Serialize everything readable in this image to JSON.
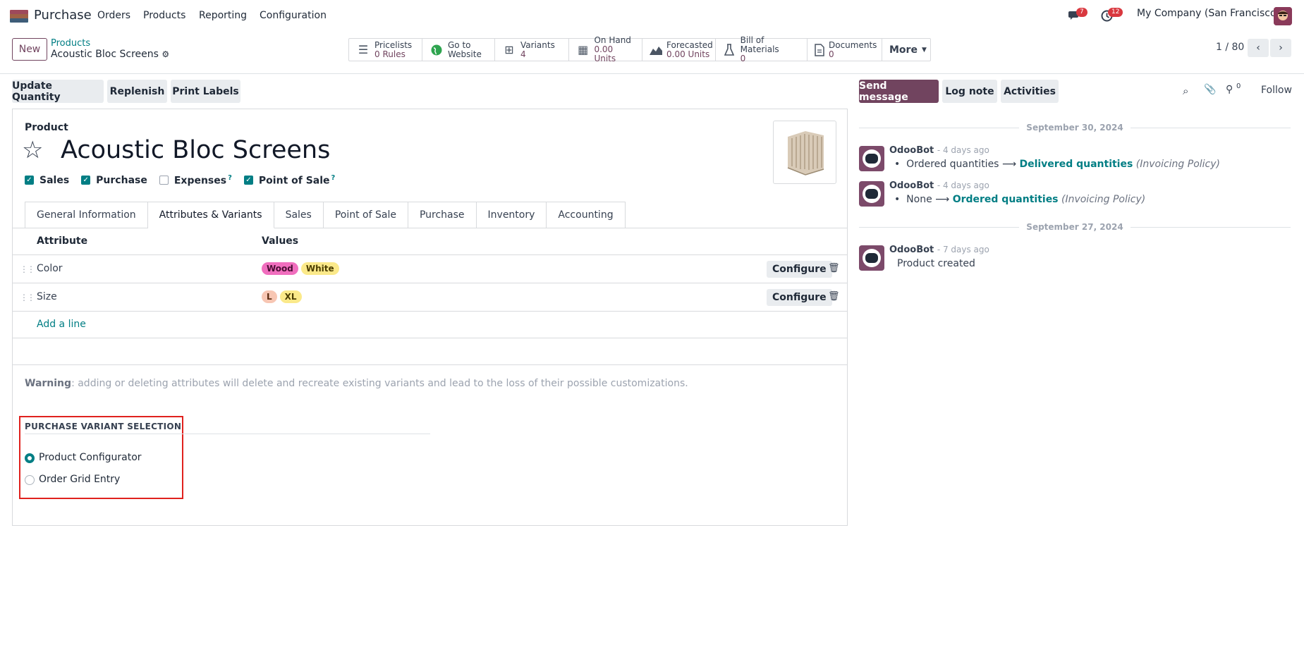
{
  "topbar": {
    "app_name": "Purchase",
    "menu": [
      "Orders",
      "Products",
      "Reporting",
      "Configuration"
    ],
    "messages_badge": "7",
    "activities_badge": "12",
    "company": "My Company (San Francisco)"
  },
  "control": {
    "new_label": "New",
    "breadcrumb_parent": "Products",
    "breadcrumb_current": "Acoustic Bloc Screens",
    "pager": "1 / 80",
    "stats": [
      {
        "icon": "list-icon",
        "label": "Pricelists",
        "value": "0 Rules"
      },
      {
        "icon": "globe-icon",
        "label": "Go to",
        "value": "Website"
      },
      {
        "icon": "sitemap-icon",
        "label": "Variants",
        "value": "4"
      },
      {
        "icon": "cubes-icon",
        "label": "On Hand",
        "value": "0.00 Units"
      },
      {
        "icon": "area-chart-icon",
        "label": "Forecasted",
        "value": "0.00 Units"
      },
      {
        "icon": "flask-icon",
        "label": "Bill of Materials",
        "value": "0"
      },
      {
        "icon": "file-icon",
        "label": "Documents",
        "value": "0"
      }
    ],
    "more_label": "More"
  },
  "actions": {
    "update_quantity": "Update Quantity",
    "replenish": "Replenish",
    "print_labels": "Print Labels"
  },
  "form": {
    "type_label": "Product",
    "name": "Acoustic Bloc Screens",
    "checkboxes": [
      {
        "label": "Sales",
        "checked": true,
        "help": false
      },
      {
        "label": "Purchase",
        "checked": true,
        "help": false
      },
      {
        "label": "Expenses",
        "checked": false,
        "help": true
      },
      {
        "label": "Point of Sale",
        "checked": true,
        "help": true
      }
    ],
    "help_mark": "?",
    "tabs": [
      "General Information",
      "Attributes & Variants",
      "Sales",
      "Point of Sale",
      "Purchase",
      "Inventory",
      "Accounting"
    ],
    "active_tab": "Attributes & Variants",
    "table": {
      "headers": [
        "Attribute",
        "Values"
      ],
      "rows": [
        {
          "attribute": "Color",
          "values": [
            {
              "text": "Wood",
              "color": "#f06ebe"
            },
            {
              "text": "White",
              "color": "#fbe98a"
            }
          ]
        },
        {
          "attribute": "Size",
          "values": [
            {
              "text": "L",
              "color": "#f7c6b3"
            },
            {
              "text": "XL",
              "color": "#fbe98a"
            }
          ]
        }
      ],
      "configure_label": "Configure",
      "add_line": "Add a line"
    },
    "warning_bold": "Warning",
    "warning_text": ": adding or deleting attributes will delete and recreate existing variants and lead to the loss of their possible customizations.",
    "pvs_title": "PURCHASE VARIANT SELECTION",
    "pvs_options": [
      {
        "label": "Product Configurator",
        "selected": true
      },
      {
        "label": "Order Grid Entry",
        "selected": false
      }
    ]
  },
  "chatter": {
    "send_message": "Send message",
    "log_note": "Log note",
    "activities": "Activities",
    "followers_count": "0",
    "follow": "Follow",
    "dates": [
      "September 30, 2024",
      "September 27, 2024"
    ],
    "messages": [
      {
        "author": "OdooBot",
        "ago": "- 4 days ago",
        "old": "Ordered quantities",
        "new": "Delivered quantities",
        "field": "(Invoicing Policy)"
      },
      {
        "author": "OdooBot",
        "ago": "- 4 days ago",
        "old": "None",
        "new": "Ordered quantities",
        "field": "(Invoicing Policy)"
      },
      {
        "author": "OdooBot",
        "ago": "- 7 days ago",
        "body": "Product created"
      }
    ]
  },
  "colors": {
    "brand": "#71445f",
    "teal": "#017e84",
    "highlight_box": "#e0211e"
  }
}
